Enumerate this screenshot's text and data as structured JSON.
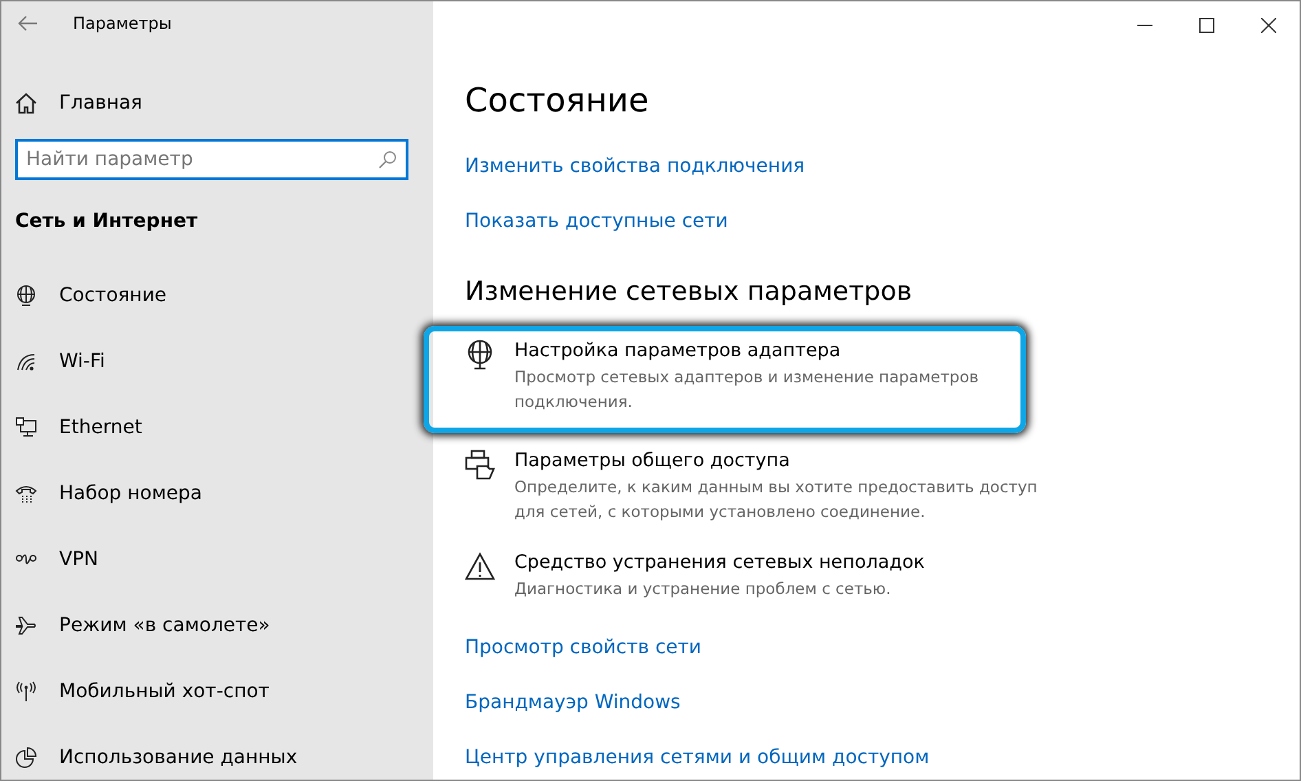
{
  "window": {
    "title": "Параметры"
  },
  "sidebar": {
    "home": "Главная",
    "search": {
      "placeholder": "Найти параметр"
    },
    "section": "Сеть и Интернет",
    "items": [
      {
        "label": "Состояние"
      },
      {
        "label": "Wi-Fi"
      },
      {
        "label": "Ethernet"
      },
      {
        "label": "Набор номера"
      },
      {
        "label": "VPN"
      },
      {
        "label": "Режим «в самолете»"
      },
      {
        "label": "Мобильный хот-спот"
      },
      {
        "label": "Использование данных"
      }
    ]
  },
  "main": {
    "heading": "Состояние",
    "top_links": [
      "Изменить свойства подключения",
      "Показать доступные сети"
    ],
    "subheading": "Изменение сетевых параметров",
    "options": [
      {
        "title": "Настройка параметров адаптера",
        "description": "Просмотр сетевых адаптеров и изменение параметров подключения.",
        "highlighted": true
      },
      {
        "title": "Параметры общего доступа",
        "description": "Определите, к каким данным вы хотите предоставить доступ для сетей, с которыми установлено соединение.",
        "highlighted": false
      },
      {
        "title": "Средство устранения сетевых неполадок",
        "description": "Диагностика и устранение проблем с сетью.",
        "highlighted": false
      }
    ],
    "bottom_links": [
      "Просмотр свойств сети",
      "Брандмауэр Windows",
      "Центр управления сетями и общим доступом"
    ]
  }
}
